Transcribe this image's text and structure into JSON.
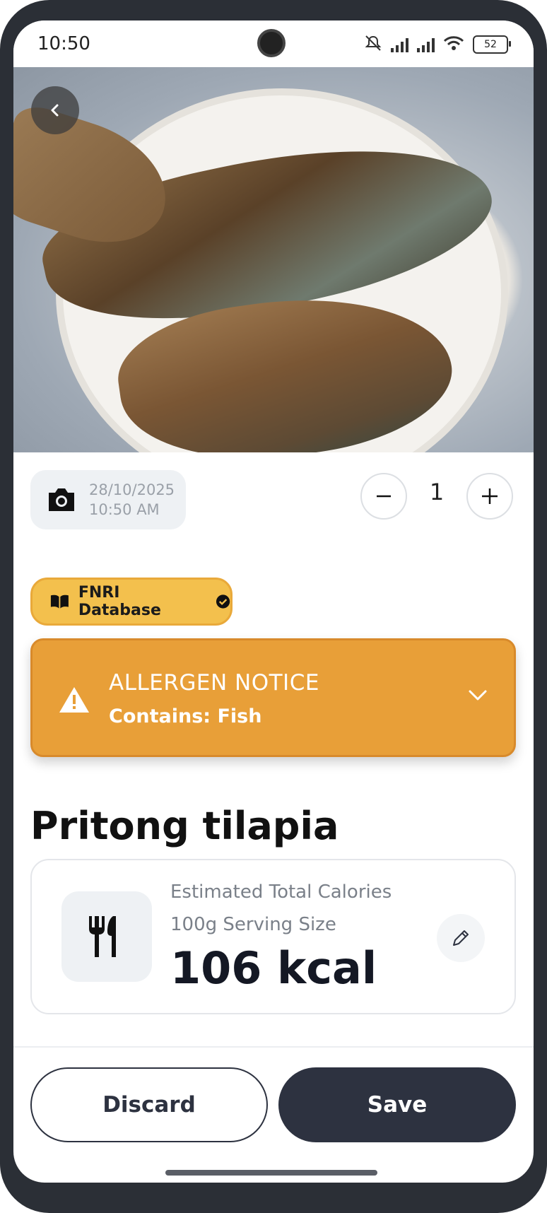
{
  "status_bar": {
    "time": "10:50",
    "battery": "52"
  },
  "photo": {
    "timestamp_date": "28/10/2025",
    "timestamp_time": "10:50 AM"
  },
  "quantity": {
    "value": "1"
  },
  "source_badge": {
    "label": "FNRI Database",
    "color": "#f3c04d"
  },
  "allergen": {
    "title": "ALLERGEN NOTICE",
    "detail": "Contains: Fish",
    "color": "#e89f38"
  },
  "food": {
    "name": "Pritong tilapia"
  },
  "calories": {
    "label": "Estimated Total Calories",
    "serving": "100g Serving Size",
    "value": "106 kcal"
  },
  "actions": {
    "discard_label": "Discard",
    "save_label": "Save"
  },
  "icons": [
    "back-icon",
    "camera-icon",
    "minus-icon",
    "plus-icon",
    "book-icon",
    "check-circle-icon",
    "warning-icon",
    "chevron-down-icon",
    "utensils-icon",
    "pencil-icon"
  ]
}
